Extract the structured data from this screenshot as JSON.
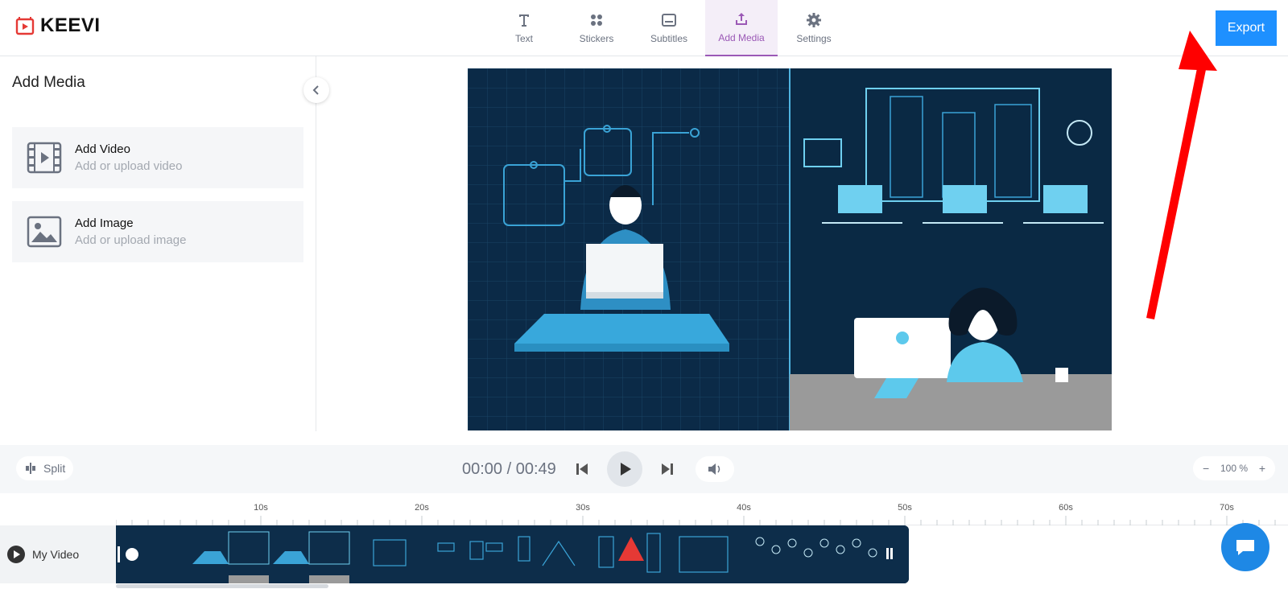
{
  "app": {
    "name": "KEEVI"
  },
  "tabs": [
    {
      "label": "Text",
      "icon": "text-icon",
      "active": false
    },
    {
      "label": "Stickers",
      "icon": "stickers-icon",
      "active": false
    },
    {
      "label": "Subtitles",
      "icon": "subtitles-icon",
      "active": false
    },
    {
      "label": "Add Media",
      "icon": "upload-icon",
      "active": true
    },
    {
      "label": "Settings",
      "icon": "gear-icon",
      "active": false
    }
  ],
  "export_label": "Export",
  "panel": {
    "title": "Add Media",
    "items": [
      {
        "title": "Add Video",
        "subtitle": "Add or upload video",
        "icon": "video-icon"
      },
      {
        "title": "Add Image",
        "subtitle": "Add or upload image",
        "icon": "image-icon"
      }
    ]
  },
  "controls": {
    "split_label": "Split",
    "time": "00:00 / 00:49",
    "zoom": "100 %"
  },
  "timeline": {
    "ticks": [
      "10s",
      "20s",
      "30s",
      "40s",
      "50s",
      "60s",
      "70s"
    ],
    "track_label": "My Video"
  },
  "colors": {
    "accent": "#9b59b6",
    "export": "#1e90ff",
    "brand_logo": "#e53935",
    "annotation_arrow": "#ff0000",
    "chat": "#1e88e5"
  }
}
